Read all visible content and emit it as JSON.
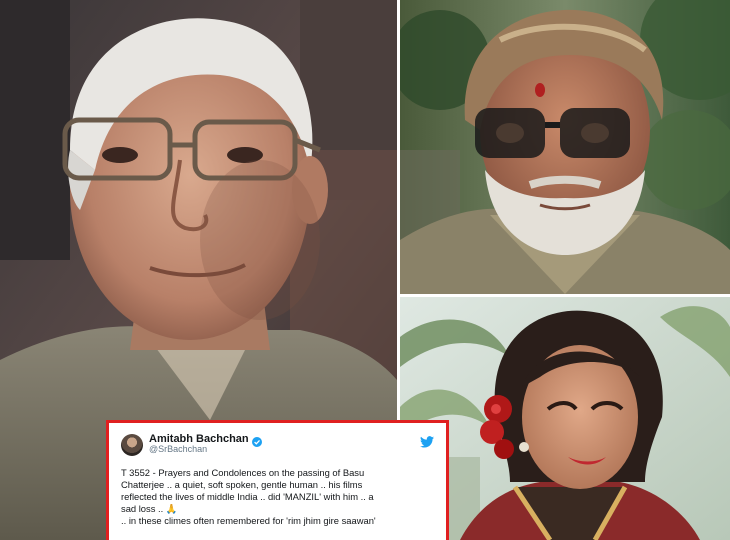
{
  "tweet": {
    "author_name": "Amitabh Bachchan",
    "author_handle": "@SrBachchan",
    "lines": [
      "T 3552 - Prayers and Condolences on the passing of Basu",
      "Chatterjee .. a quiet, soft spoken, gentle human .. his films",
      "reflected the lives of middle India .. did 'MANZIL' with him .. a",
      "sad loss .. 🙏",
      ".. in these climes often remembered for 'rim jhim gire saawan'"
    ]
  },
  "colors": {
    "tweet_border": "#e02020",
    "twitter_blue": "#1da1f2",
    "verified_blue": "#1da1f2"
  },
  "icons": [
    "verified-icon",
    "twitter-bird-icon",
    "avatar"
  ]
}
